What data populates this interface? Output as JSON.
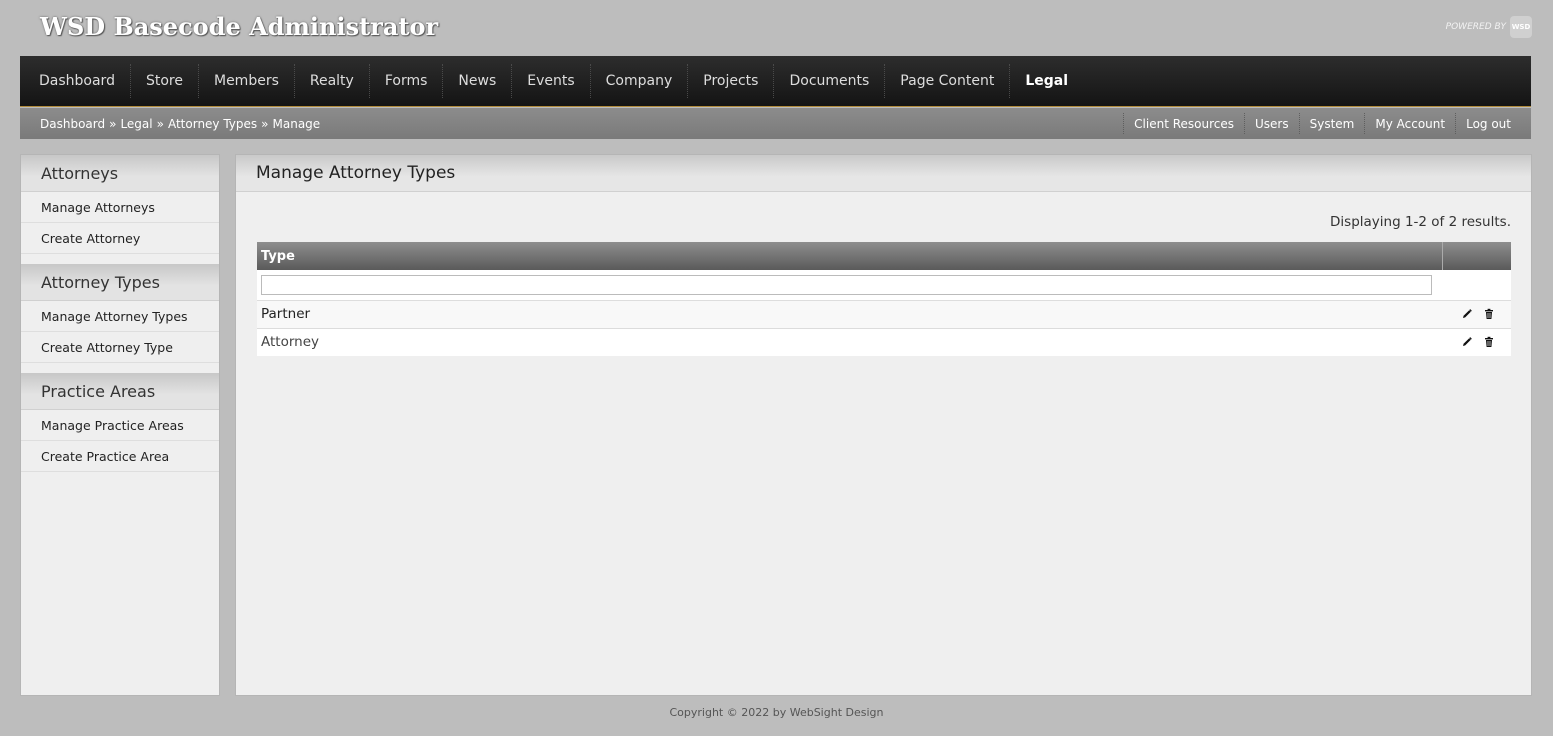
{
  "header": {
    "app_title": "WSD Basecode Administrator",
    "powered_by": "POWERED BY",
    "logo_text": "WSD"
  },
  "nav": {
    "items": [
      {
        "label": "Dashboard"
      },
      {
        "label": "Store"
      },
      {
        "label": "Members"
      },
      {
        "label": "Realty"
      },
      {
        "label": "Forms"
      },
      {
        "label": "News"
      },
      {
        "label": "Events"
      },
      {
        "label": "Company"
      },
      {
        "label": "Projects"
      },
      {
        "label": "Documents"
      },
      {
        "label": "Page Content"
      },
      {
        "label": "Legal"
      }
    ],
    "active": "Legal"
  },
  "breadcrumb": {
    "items": [
      "Dashboard",
      "Legal",
      "Attorney Types",
      "Manage"
    ],
    "separator": "»"
  },
  "util_links": [
    "Client Resources",
    "Users",
    "System",
    "My Account",
    "Log out"
  ],
  "sidebar": {
    "sections": [
      {
        "title": "Attorneys",
        "items": [
          "Manage Attorneys",
          "Create Attorney"
        ]
      },
      {
        "title": "Attorney Types",
        "items": [
          "Manage Attorney Types",
          "Create Attorney Type"
        ]
      },
      {
        "title": "Practice Areas",
        "items": [
          "Manage Practice Areas",
          "Create Practice Area"
        ]
      }
    ]
  },
  "main": {
    "title": "Manage Attorney Types",
    "summary": "Displaying 1-2 of 2 results.",
    "table": {
      "columns": [
        "Type",
        ""
      ],
      "filter_value": "",
      "rows": [
        {
          "type": "Partner"
        },
        {
          "type": "Attorney"
        }
      ]
    }
  },
  "icons": {
    "edit": "pencil-icon",
    "delete": "trash-icon"
  },
  "footer": {
    "copyright": "Copyright © 2022 by WebSight Design"
  }
}
